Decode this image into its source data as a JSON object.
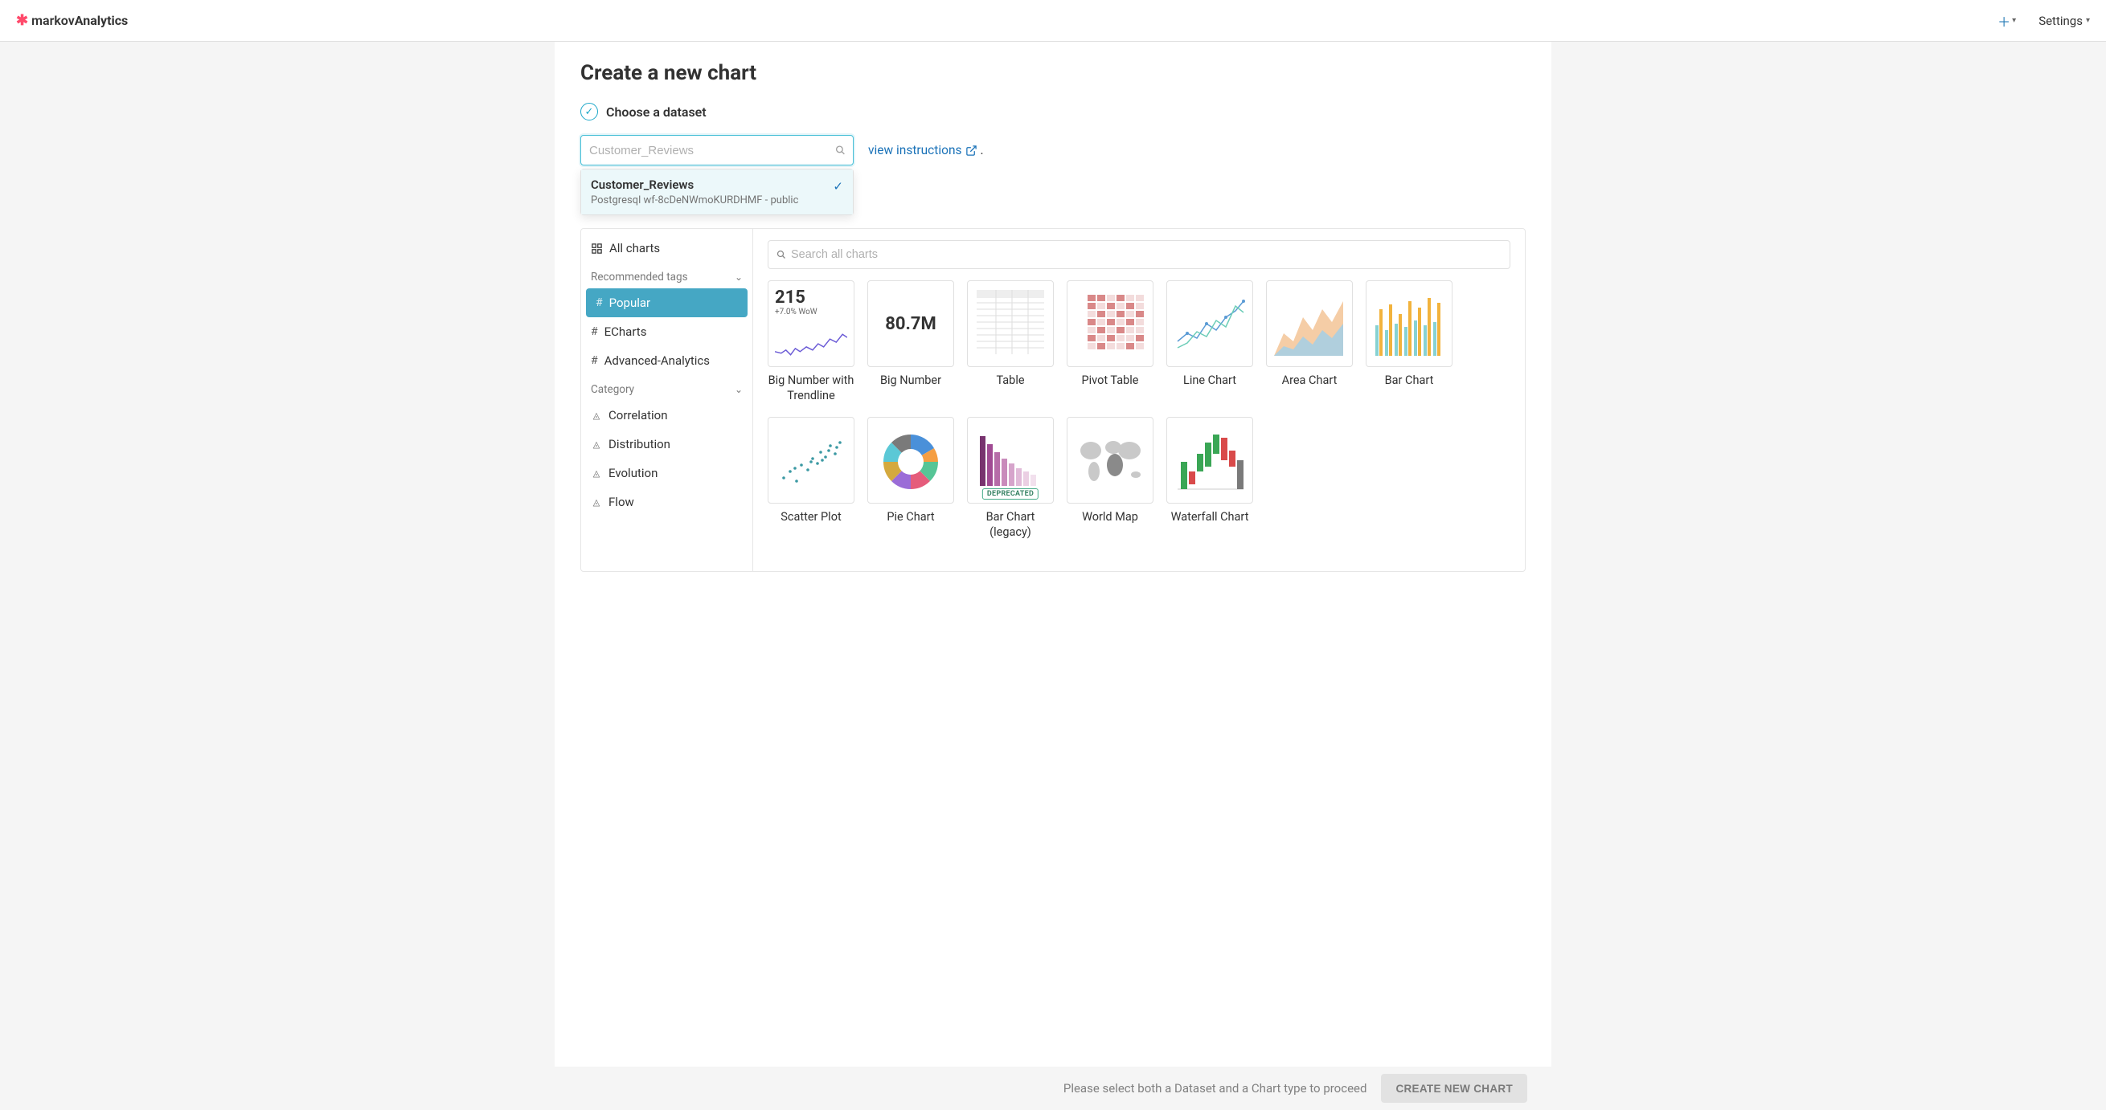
{
  "header": {
    "brand_prefix": "markov",
    "brand_suffix": "Analytics",
    "settings_label": "Settings"
  },
  "page": {
    "title": "Create a new chart",
    "step1_label": "Choose a dataset",
    "dataset_placeholder": "Customer_Reviews",
    "view_instructions": "view instructions",
    "footer_hint": "Please select both a Dataset and a Chart type to proceed",
    "create_button": "CREATE NEW CHART"
  },
  "dropdown": {
    "option_name": "Customer_Reviews",
    "option_sub": "Postgresql wf-8cDeNWmoKURDHMF - public"
  },
  "sidebar": {
    "all_charts": "All charts",
    "section_recommended": "Recommended tags",
    "tag_popular": "Popular",
    "tag_echarts": "ECharts",
    "tag_advanced": "Advanced-Analytics",
    "section_category": "Category",
    "cat_correlation": "Correlation",
    "cat_distribution": "Distribution",
    "cat_evolution": "Evolution",
    "cat_flow": "Flow"
  },
  "gallery": {
    "search_placeholder": "Search all charts",
    "bignum_value": "215",
    "bignum_delta": "+7.0% WoW",
    "bignum2_value": "80.7M",
    "deprecated_label": "DEPRECATED",
    "cards": {
      "big_number_trend": "Big Number with Trendline",
      "big_number": "Big Number",
      "table": "Table",
      "pivot_table": "Pivot Table",
      "line_chart": "Line Chart",
      "area_chart": "Area Chart",
      "bar_chart": "Bar Chart",
      "scatter_plot": "Scatter Plot",
      "pie_chart": "Pie Chart",
      "bar_legacy": "Bar Chart (legacy)",
      "world_map": "World Map",
      "waterfall": "Waterfall Chart"
    }
  }
}
